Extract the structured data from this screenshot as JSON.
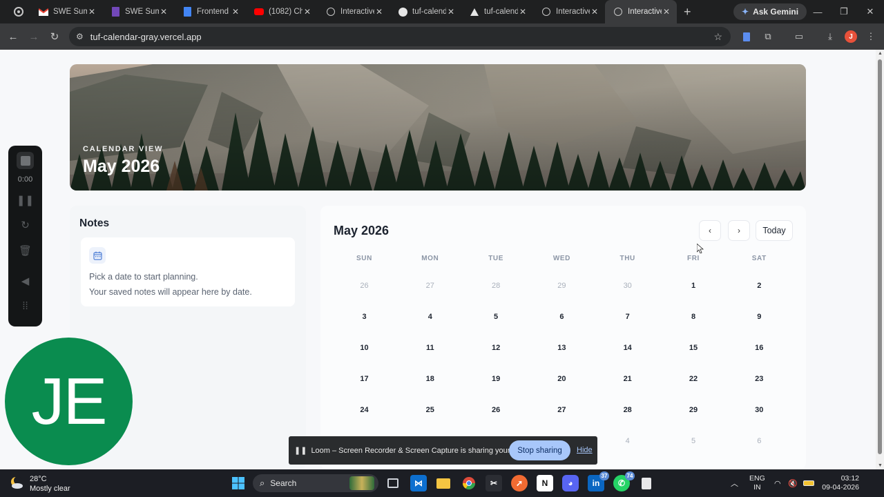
{
  "browser": {
    "tabs": [
      {
        "title": "SWE Sum",
        "icon": "gmail-icon",
        "active": false
      },
      {
        "title": "SWE Sum",
        "icon": "forms-icon",
        "active": false
      },
      {
        "title": "Frontend",
        "icon": "docs-icon",
        "active": false
      },
      {
        "title": "(1082) Ch",
        "icon": "youtube-icon",
        "active": false
      },
      {
        "title": "Interactive",
        "icon": "globe-icon",
        "active": false
      },
      {
        "title": "tuf-calend",
        "icon": "github-icon",
        "active": false
      },
      {
        "title": "tuf-calend",
        "icon": "vercel-icon",
        "active": false
      },
      {
        "title": "Interactive",
        "icon": "globe-icon",
        "active": false
      },
      {
        "title": "Interactive",
        "icon": "globe-icon",
        "active": true
      }
    ],
    "ask_gemini": "Ask Gemini",
    "url": "tuf-calendar-gray.vercel.app",
    "profile_initial": "J"
  },
  "hero": {
    "eyebrow": "CALENDAR VIEW",
    "title": "May 2026"
  },
  "notes": {
    "title": "Notes",
    "line1": "Pick a date to start planning.",
    "line2": "Your saved notes will appear here by date."
  },
  "calendar": {
    "title": "May 2026",
    "prev_label": "‹",
    "next_label": "›",
    "today_label": "Today",
    "weekdays": [
      "SUN",
      "MON",
      "TUE",
      "WED",
      "THU",
      "FRI",
      "SAT"
    ],
    "weeks": [
      [
        {
          "d": "26",
          "m": true
        },
        {
          "d": "27",
          "m": true
        },
        {
          "d": "28",
          "m": true
        },
        {
          "d": "29",
          "m": true
        },
        {
          "d": "30",
          "m": true
        },
        {
          "d": "1",
          "m": false
        },
        {
          "d": "2",
          "m": false
        }
      ],
      [
        {
          "d": "3",
          "m": false
        },
        {
          "d": "4",
          "m": false
        },
        {
          "d": "5",
          "m": false
        },
        {
          "d": "6",
          "m": false
        },
        {
          "d": "7",
          "m": false
        },
        {
          "d": "8",
          "m": false
        },
        {
          "d": "9",
          "m": false
        }
      ],
      [
        {
          "d": "10",
          "m": false
        },
        {
          "d": "11",
          "m": false
        },
        {
          "d": "12",
          "m": false
        },
        {
          "d": "13",
          "m": false
        },
        {
          "d": "14",
          "m": false
        },
        {
          "d": "15",
          "m": false
        },
        {
          "d": "16",
          "m": false
        }
      ],
      [
        {
          "d": "17",
          "m": false
        },
        {
          "d": "18",
          "m": false
        },
        {
          "d": "19",
          "m": false
        },
        {
          "d": "20",
          "m": false
        },
        {
          "d": "21",
          "m": false
        },
        {
          "d": "22",
          "m": false
        },
        {
          "d": "23",
          "m": false
        }
      ],
      [
        {
          "d": "24",
          "m": false
        },
        {
          "d": "25",
          "m": false
        },
        {
          "d": "26",
          "m": false
        },
        {
          "d": "27",
          "m": false
        },
        {
          "d": "28",
          "m": false
        },
        {
          "d": "29",
          "m": false
        },
        {
          "d": "30",
          "m": false
        }
      ],
      [
        {
          "d": "",
          "m": true
        },
        {
          "d": "",
          "m": true
        },
        {
          "d": "",
          "m": true
        },
        {
          "d": "",
          "m": true
        },
        {
          "d": "4",
          "m": true
        },
        {
          "d": "5",
          "m": true
        },
        {
          "d": "6",
          "m": true
        }
      ]
    ]
  },
  "loom": {
    "timer": "0:00",
    "avatar_initials": "JE",
    "share_message": "Loom – Screen Recorder & Screen Capture is sharing your screen.",
    "stop_sharing": "Stop sharing",
    "hide": "Hide"
  },
  "taskbar": {
    "weather_temp": "28°C",
    "weather_condition": "Mostly clear",
    "search_placeholder": "Search",
    "linkedin_badge": "37",
    "whatsapp_badge": "74",
    "lang_line1": "ENG",
    "lang_line2": "IN",
    "time": "03:12",
    "date": "09-04-2026"
  },
  "colors": {
    "accent": "#a8c7fa",
    "avatar_green": "#0a8c4f",
    "chrome_dark": "#1f2021"
  }
}
